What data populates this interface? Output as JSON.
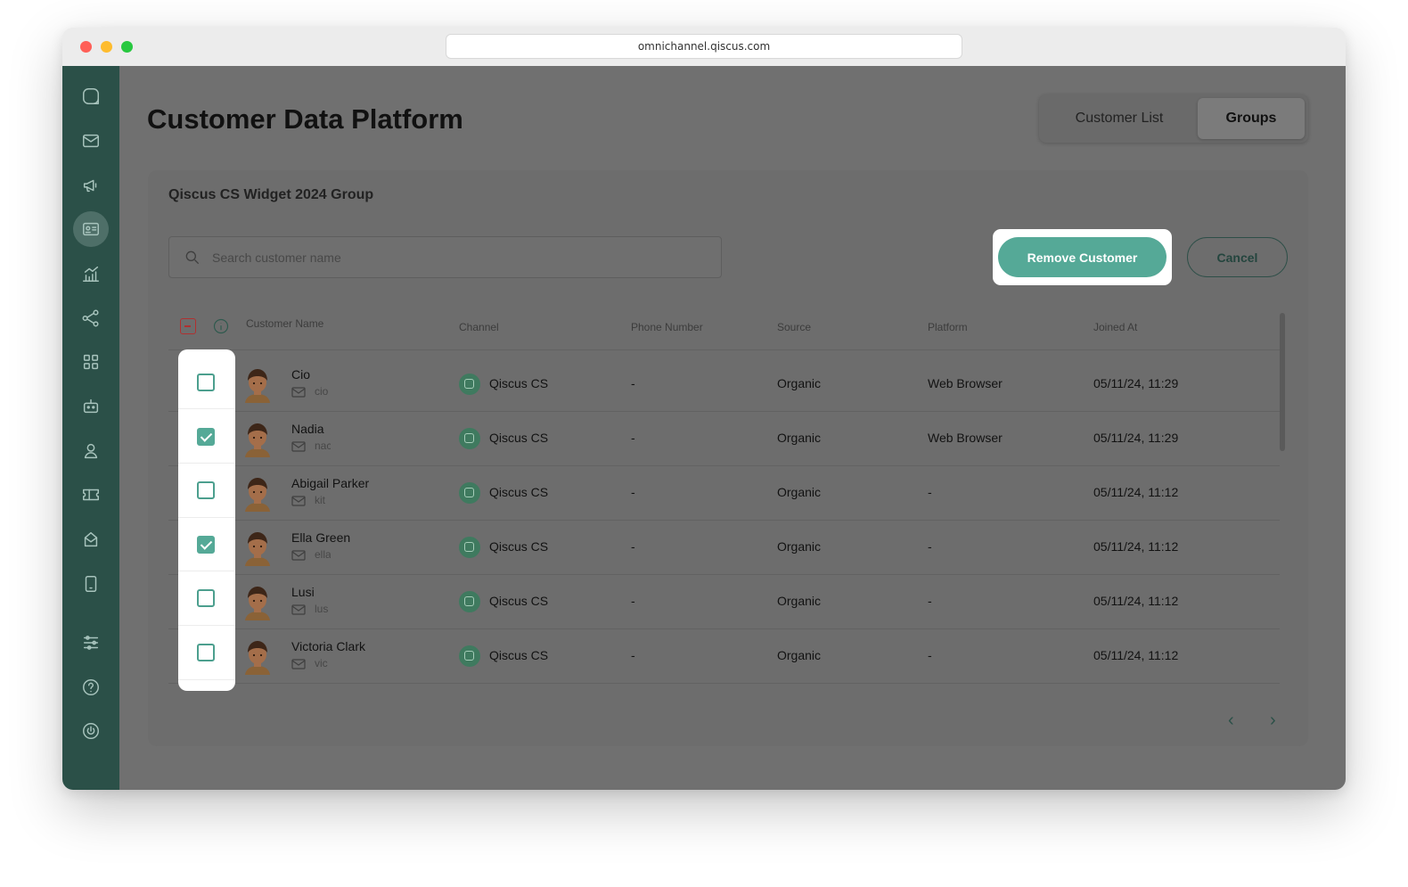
{
  "browser": {
    "url": "omnichannel.qiscus.com"
  },
  "sidebar": {
    "items": [
      {
        "icon": "qiscus-logo-icon"
      },
      {
        "icon": "inbox-icon"
      },
      {
        "icon": "megaphone-icon"
      },
      {
        "icon": "contact-card-icon",
        "active": true
      },
      {
        "icon": "analytics-icon"
      },
      {
        "icon": "integration-icon"
      },
      {
        "icon": "apps-grid-icon"
      },
      {
        "icon": "bot-icon"
      },
      {
        "icon": "agent-icon"
      },
      {
        "icon": "ticket-icon"
      },
      {
        "icon": "mailbox-icon"
      },
      {
        "icon": "mobile-icon"
      },
      {
        "icon": "settings-sliders-icon"
      },
      {
        "icon": "help-icon"
      },
      {
        "icon": "power-icon"
      }
    ]
  },
  "page": {
    "title": "Customer Data Platform",
    "tabs": [
      {
        "label": "Customer List",
        "active": false
      },
      {
        "label": "Groups",
        "active": true
      }
    ]
  },
  "group": {
    "title": "Qiscus CS Widget 2024 Group",
    "search_placeholder": "Search customer name",
    "remove_label": "Remove Customer",
    "cancel_label": "Cancel"
  },
  "table": {
    "columns": {
      "name": "Customer Name",
      "channel": "Channel",
      "phone": "Phone Number",
      "source": "Source",
      "platform": "Platform",
      "joined": "Joined At"
    },
    "rows": [
      {
        "name": "Cio",
        "email": "cio",
        "channel": "Qiscus CS",
        "phone": "-",
        "source": "Organic",
        "platform": "Web Browser",
        "joined": "05/11/24, 11:29",
        "checked": false
      },
      {
        "name": "Nadia",
        "email": "nac",
        "channel": "Qiscus CS",
        "phone": "-",
        "source": "Organic",
        "platform": "Web Browser",
        "joined": "05/11/24, 11:29",
        "checked": true
      },
      {
        "name": "Abigail Parker",
        "email": "kit",
        "channel": "Qiscus CS",
        "phone": "-",
        "source": "Organic",
        "platform": "-",
        "joined": "05/11/24, 11:12",
        "checked": false
      },
      {
        "name": "Ella Green",
        "email": "ella",
        "channel": "Qiscus CS",
        "phone": "-",
        "source": "Organic",
        "platform": "-",
        "joined": "05/11/24, 11:12",
        "checked": true
      },
      {
        "name": "Lusi",
        "email": "lus",
        "channel": "Qiscus CS",
        "phone": "-",
        "source": "Organic",
        "platform": "-",
        "joined": "05/11/24, 11:12",
        "checked": false
      },
      {
        "name": "Victoria Clark",
        "email": "vic",
        "channel": "Qiscus CS",
        "phone": "-",
        "source": "Organic",
        "platform": "-",
        "joined": "05/11/24, 11:12",
        "checked": false
      }
    ]
  },
  "pagination": {
    "prev": "‹",
    "next": "›"
  },
  "colors": {
    "sidebar": "#2b5048",
    "accent": "#55a997",
    "overlay": "#707070"
  }
}
